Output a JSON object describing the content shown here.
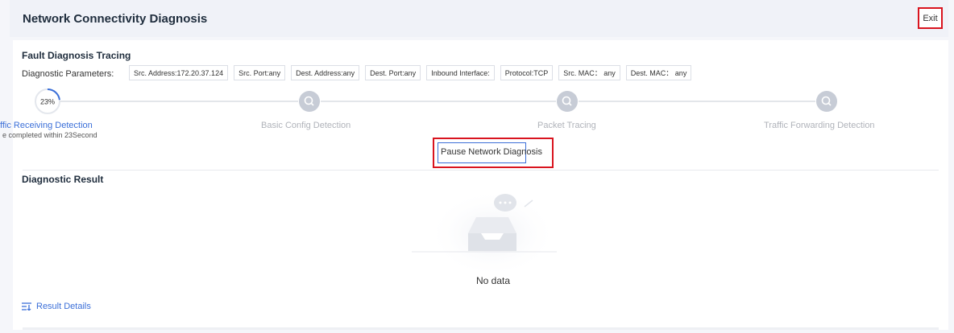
{
  "header": {
    "title": "Network Connectivity Diagnosis",
    "exit_label": "Exit"
  },
  "tracing": {
    "title": "Fault Diagnosis Tracing",
    "params_label": "Diagnostic Parameters:",
    "params": [
      "Src. Address:172.20.37.124",
      "Src. Port:any",
      "Dest. Address:any",
      "Dest. Port:any",
      "Inbound Interface:",
      "Protocol:TCP",
      "Src. MAC： any",
      "Dest. MAC： any"
    ]
  },
  "steps": [
    {
      "label": "ffic Receiving Detection",
      "status": "active",
      "progress_text": "23%",
      "progress": 0.23,
      "note": "e completed within 23Second"
    },
    {
      "label": "Basic Config Detection",
      "status": "pending",
      "icon": "search-icon"
    },
    {
      "label": "Packet Tracing",
      "status": "pending",
      "icon": "search-icon"
    },
    {
      "label": "Traffic Forwarding Detection",
      "status": "pending",
      "icon": "search-icon"
    }
  ],
  "pause_button_label": "Pause Network Diagnosis",
  "result": {
    "title": "Diagnostic Result",
    "empty_text": "No data",
    "details_link": "Result Details",
    "details_icon": "list-filter-icon"
  },
  "colors": {
    "accent": "#3b6fd8",
    "highlight": "#d9141f",
    "step_icon": "#c7ccd6"
  }
}
